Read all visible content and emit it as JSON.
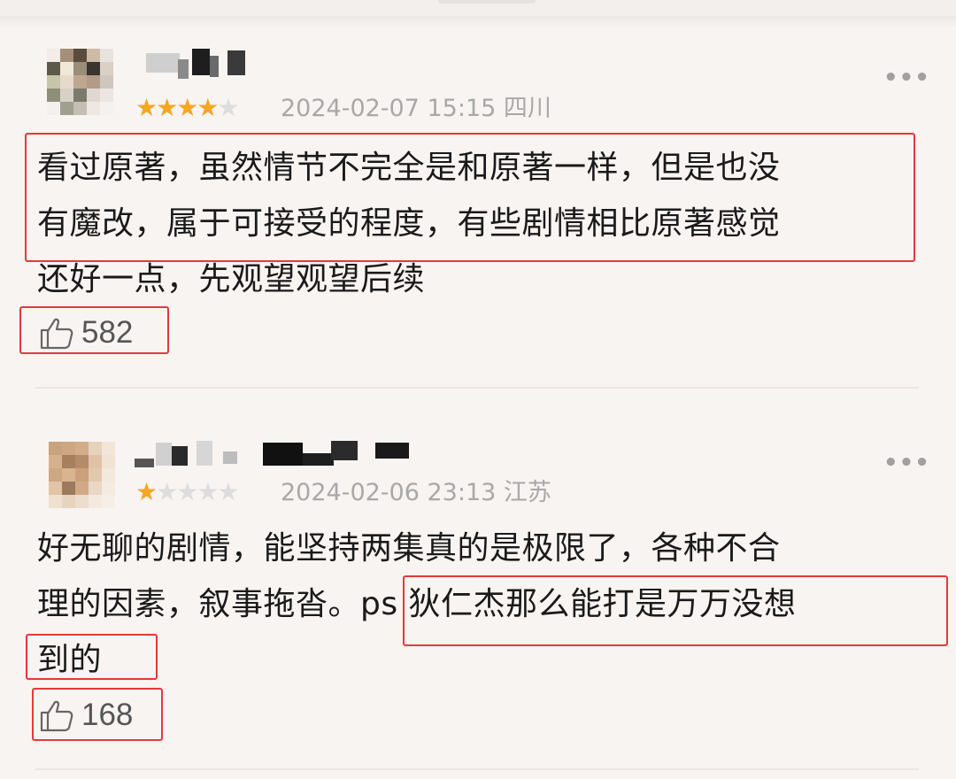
{
  "comments": [
    {
      "rating": "4",
      "stars_on": "★★★★",
      "stars_off": "★",
      "timestamp": "2024-02-07 15:15 四川",
      "text_lines": [
        "看过原著，虽然情节不完全是和原著一样，但是也没",
        "有魔改，属于可接受的程度，有些剧情相比原著感觉",
        "还好一点，先观望观望后续"
      ],
      "likes": "582",
      "more_label": "•••"
    },
    {
      "rating": "1",
      "stars_on": "★",
      "stars_off": "★★★★",
      "timestamp": "2024-02-06 23:13 江苏",
      "text_lines": [
        "好无聊的剧情，能坚持两集真的是极限了，各种不合",
        "理的因素，叙事拖沓。ps 狄仁杰那么能打是万万没想",
        "到的"
      ],
      "likes": "168",
      "more_label": "•••"
    }
  ],
  "colors": {
    "star_active": "#f5a623",
    "star_inactive": "#dddddd",
    "highlight_box": "#e43a3a",
    "background": "#f8f4f2"
  },
  "icons": {
    "like": "thumbs-up-icon",
    "more": "more-dots-icon"
  }
}
